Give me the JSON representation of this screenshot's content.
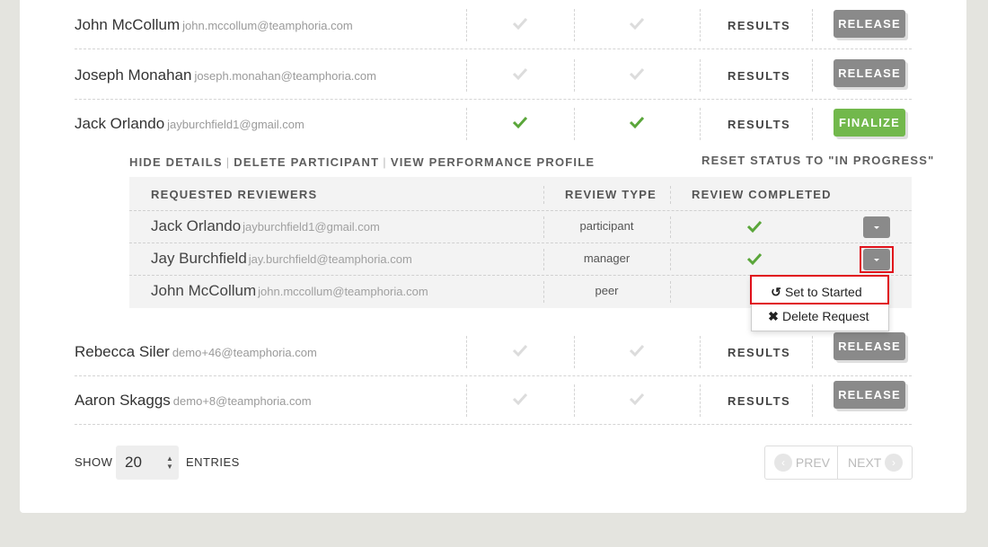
{
  "participants": [
    {
      "name": "John McCollum",
      "email": "john.mccollum@teamphoria.com",
      "status1": "pending",
      "status2": "pending",
      "results": "RESULTS",
      "action": "RELEASE"
    },
    {
      "name": "Joseph Monahan",
      "email": "joseph.monahan@teamphoria.com",
      "status1": "pending",
      "status2": "pending",
      "results": "RESULTS",
      "action": "RELEASE"
    },
    {
      "name": "Jack Orlando",
      "email": "jayburchfield1@gmail.com",
      "status1": "done",
      "status2": "done",
      "results": "RESULTS",
      "action": "FINALIZE"
    },
    {
      "name": "Rebecca Siler",
      "email": "demo+46@teamphoria.com",
      "status1": "pending",
      "status2": "pending",
      "results": "RESULTS",
      "action": "RELEASE"
    },
    {
      "name": "Aaron Skaggs",
      "email": "demo+8@teamphoria.com",
      "status1": "pending",
      "status2": "pending",
      "results": "RESULTS",
      "action": "RELEASE"
    }
  ],
  "details": {
    "hide_details": "HIDE DETAILS",
    "delete_participant": "DELETE PARTICIPANT",
    "view_profile": "VIEW PERFORMANCE PROFILE",
    "separator": "|",
    "reset_status": "RESET STATUS TO \"IN PROGRESS\"",
    "headers": {
      "reviewers": "REQUESTED REVIEWERS",
      "type": "REVIEW TYPE",
      "completed": "REVIEW COMPLETED"
    },
    "reviewers": [
      {
        "name": "Jack Orlando",
        "email": "jayburchfield1@gmail.com",
        "type": "participant",
        "completed": true
      },
      {
        "name": "Jay Burchfield",
        "email": "jay.burchfield@teamphoria.com",
        "type": "manager",
        "completed": true
      },
      {
        "name": "John McCollum",
        "email": "john.mccollum@teamphoria.com",
        "type": "peer",
        "completed": false
      }
    ]
  },
  "dropdown_menu": {
    "set_started": {
      "icon": "history-icon",
      "label": "Set to Started"
    },
    "delete_request": {
      "icon": "times-icon",
      "label": "Delete Request"
    }
  },
  "footer": {
    "show": "SHOW",
    "entries_value": "20",
    "entries": "ENTRIES",
    "prev": "PREV",
    "next": "NEXT"
  },
  "colors": {
    "accent_green": "#72b84c",
    "button_gray": "#8a8a8a",
    "highlight_red": "#e0101a",
    "background": "#e4e4df"
  }
}
